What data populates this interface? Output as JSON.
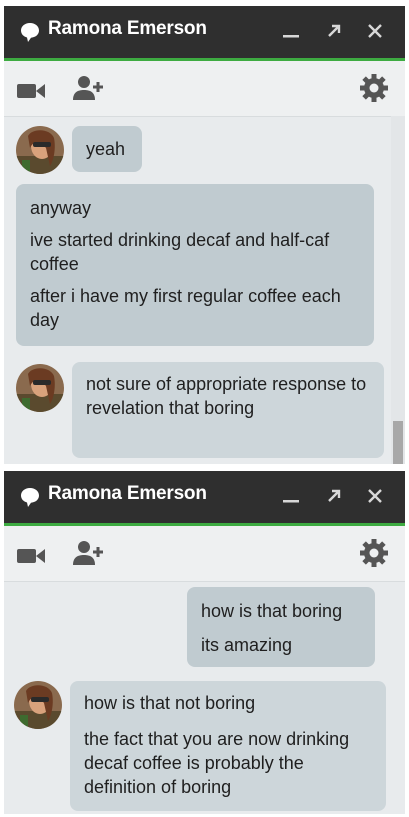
{
  "panel1": {
    "title": "Ramona Emerson",
    "messages": [
      {
        "from": "contact",
        "lines": [
          "yeah"
        ]
      },
      {
        "from": "contact",
        "lines": [
          "anyway",
          "ive started drinking decaf and half-caf coffee",
          "after i have my first regular coffee each day"
        ]
      },
      {
        "from": "me",
        "lines": [
          "not sure of appropriate response to revelation that boring"
        ]
      }
    ]
  },
  "panel2": {
    "title": "Ramona Emerson",
    "messages": [
      {
        "from": "me",
        "lines": [
          "how is that boring",
          "its amazing"
        ]
      },
      {
        "from": "contact",
        "lines": [
          "how is that not boring",
          "the fact that you are now drinking decaf coffee is probably the definition of boring"
        ]
      }
    ]
  },
  "icons": {
    "chat": "chat-bubble-icon",
    "minimize": "minimize-icon",
    "popout": "popout-arrow-icon",
    "close": "close-icon",
    "video": "video-camera-icon",
    "add_person": "add-person-icon",
    "settings": "gear-icon"
  },
  "colors": {
    "titlebar": "#2f2f2f",
    "accent": "#3dab41",
    "bubble": "#c0cbd0",
    "panel": "#e8ebed"
  }
}
